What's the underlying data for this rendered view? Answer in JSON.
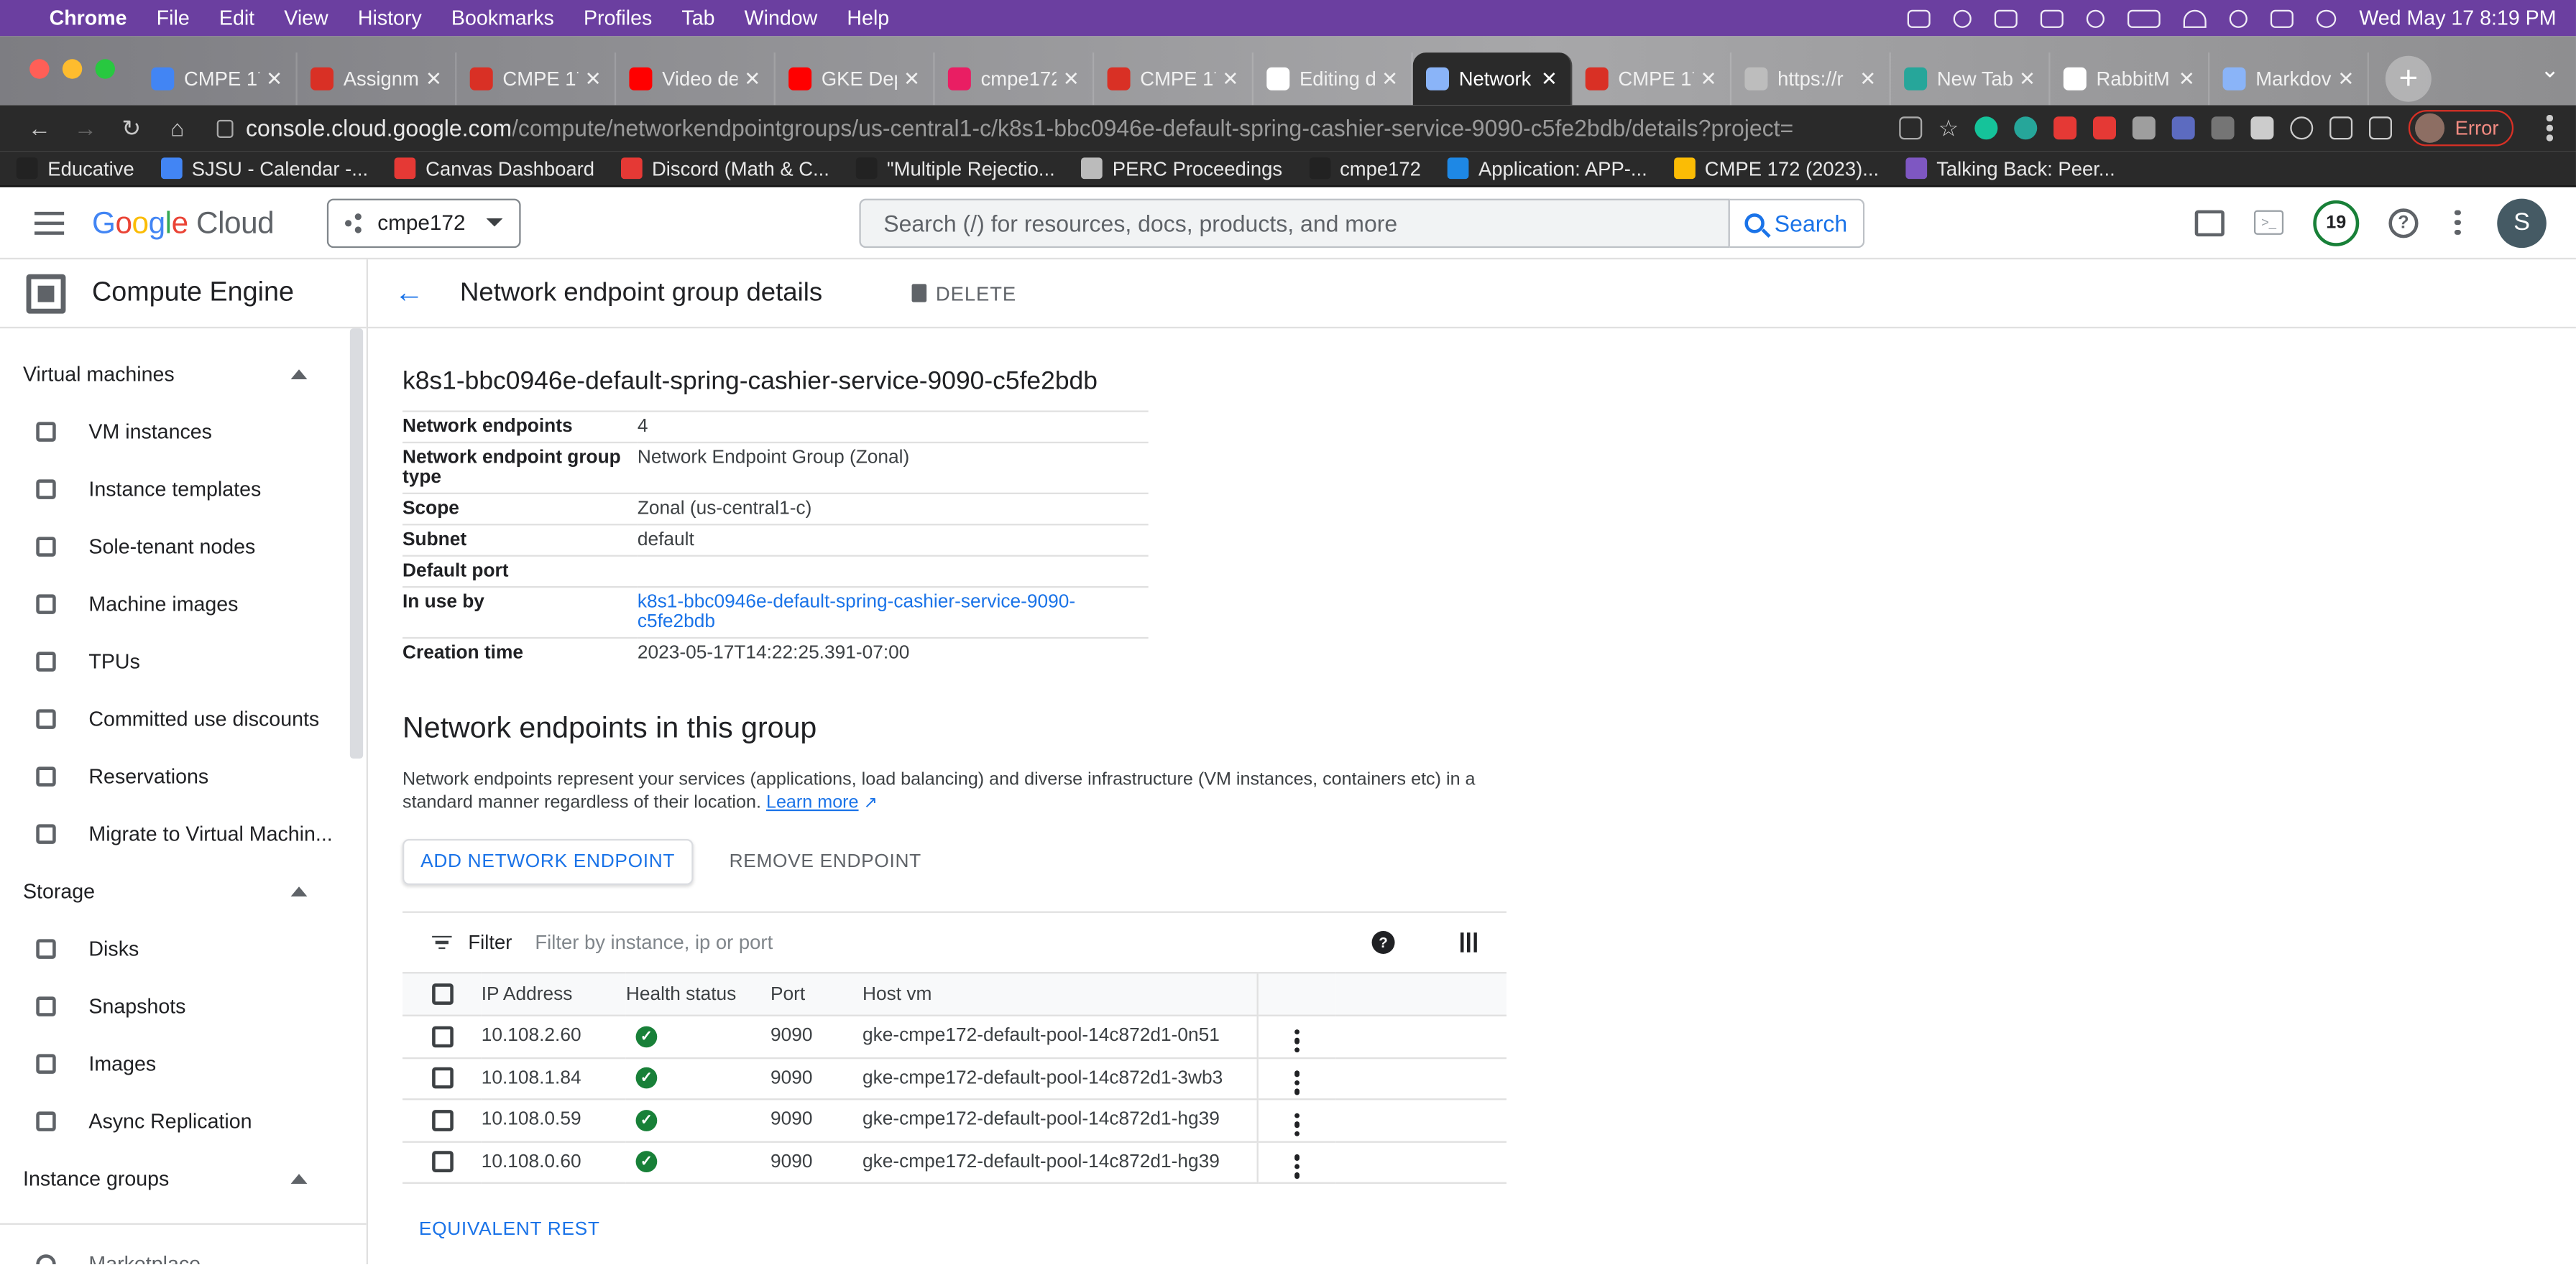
{
  "menubar": {
    "app": "Chrome",
    "items": [
      "File",
      "Edit",
      "View",
      "History",
      "Bookmarks",
      "Profiles",
      "Tab",
      "Window",
      "Help"
    ],
    "datetime": "Wed May 17  8:19 PM"
  },
  "tabs": [
    {
      "title": "CMPE 17",
      "color": "#4285f4"
    },
    {
      "title": "Assignm",
      "color": "#d93025"
    },
    {
      "title": "CMPE 17",
      "color": "#d93025"
    },
    {
      "title": "Video de",
      "color": "#ff0000"
    },
    {
      "title": "GKE Dep",
      "color": "#ff0000"
    },
    {
      "title": "cmpe172",
      "color": "#e91e63"
    },
    {
      "title": "CMPE 17",
      "color": "#d93025"
    },
    {
      "title": "Editing d",
      "color": "#ffffff"
    },
    {
      "title": "Network",
      "color": "#8ab4f8",
      "active": true
    },
    {
      "title": "CMPE 17",
      "color": "#d93025"
    },
    {
      "title": "https://r",
      "color": "#bdbdbd"
    },
    {
      "title": "New Tab",
      "color": "#26a69a"
    },
    {
      "title": "RabbitM",
      "color": "#ffffff"
    },
    {
      "title": "Markdov",
      "color": "#8ab4f8"
    }
  ],
  "address": {
    "host": "console.cloud.google.com",
    "path": "/compute/networkendpointgroups/us-central1-c/k8s1-bbc0946e-default-spring-cashier-service-9090-c5fe2bdb/details?project=cmp...",
    "error_label": "Error"
  },
  "bookmarks": [
    {
      "label": "Educative",
      "color": "#222"
    },
    {
      "label": "SJSU - Calendar -...",
      "color": "#4285f4"
    },
    {
      "label": "Canvas Dashboard",
      "color": "#e53935"
    },
    {
      "label": "Discord (Math & C...",
      "color": "#e53935"
    },
    {
      "label": "\"Multiple Rejectio...",
      "color": "#222"
    },
    {
      "label": "PERC Proceedings",
      "color": "#bbb"
    },
    {
      "label": "cmpe172",
      "color": "#222"
    },
    {
      "label": "Application: APP-...",
      "color": "#1e88e5"
    },
    {
      "label": "CMPE 172 (2023)...",
      "color": "#fbbc05"
    },
    {
      "label": "Talking Back: Peer...",
      "color": "#7e57c2"
    }
  ],
  "header": {
    "logo_google": "Google",
    "logo_cloud": "Cloud",
    "project": "cmpe172",
    "search_placeholder": "Search (/) for resources, docs, products, and more",
    "search_button": "Search",
    "notif_count": "19",
    "avatar": "S"
  },
  "sidebar": {
    "title": "Compute Engine",
    "sections": [
      {
        "label": "Virtual machines",
        "items": [
          "VM instances",
          "Instance templates",
          "Sole-tenant nodes",
          "Machine images",
          "TPUs",
          "Committed use discounts",
          "Reservations",
          "Migrate to Virtual Machin..."
        ]
      },
      {
        "label": "Storage",
        "items": [
          "Disks",
          "Snapshots",
          "Images",
          "Async Replication"
        ]
      },
      {
        "label": "Instance groups",
        "items": []
      }
    ],
    "footer_item": "Marketplace"
  },
  "page": {
    "title": "Network endpoint group details",
    "delete_label": "DELETE",
    "neg_name": "k8s1-bbc0946e-default-spring-cashier-service-9090-c5fe2bdb",
    "properties": [
      {
        "key": "Network endpoints",
        "value": "4"
      },
      {
        "key": "Network endpoint group type",
        "value": "Network Endpoint Group (Zonal)"
      },
      {
        "key": "Scope",
        "value": "Zonal (us-central1-c)"
      },
      {
        "key": "Subnet",
        "value": "default"
      },
      {
        "key": "Default port",
        "value": ""
      },
      {
        "key": "In use by",
        "value": "k8s1-bbc0946e-default-spring-cashier-service-9090-c5fe2bdb",
        "link": true
      },
      {
        "key": "Creation time",
        "value": "2023-05-17T14:22:25.391-07:00"
      }
    ],
    "section_title": "Network endpoints in this group",
    "description": " Network endpoints represent your services (applications, load balancing) and diverse infrastructure (VM instances, containers etc) in a standard manner regardless of their location.",
    "learn_more": "Learn more",
    "add_button": "ADD NETWORK ENDPOINT",
    "remove_button": "REMOVE ENDPOINT",
    "filter_label": "Filter",
    "filter_placeholder": "Filter by instance, ip or port",
    "columns": [
      "IP Address",
      "Health status",
      "Port",
      "Host vm"
    ],
    "rows": [
      {
        "ip": "10.108.2.60",
        "health": "healthy",
        "port": "9090",
        "host": "gke-cmpe172-default-pool-14c872d1-0n51"
      },
      {
        "ip": "10.108.1.84",
        "health": "healthy",
        "port": "9090",
        "host": "gke-cmpe172-default-pool-14c872d1-3wb3"
      },
      {
        "ip": "10.108.0.59",
        "health": "healthy",
        "port": "9090",
        "host": "gke-cmpe172-default-pool-14c872d1-hg39"
      },
      {
        "ip": "10.108.0.60",
        "health": "healthy",
        "port": "9090",
        "host": "gke-cmpe172-default-pool-14c872d1-hg39"
      }
    ],
    "equivalent_rest": "EQUIVALENT REST"
  }
}
